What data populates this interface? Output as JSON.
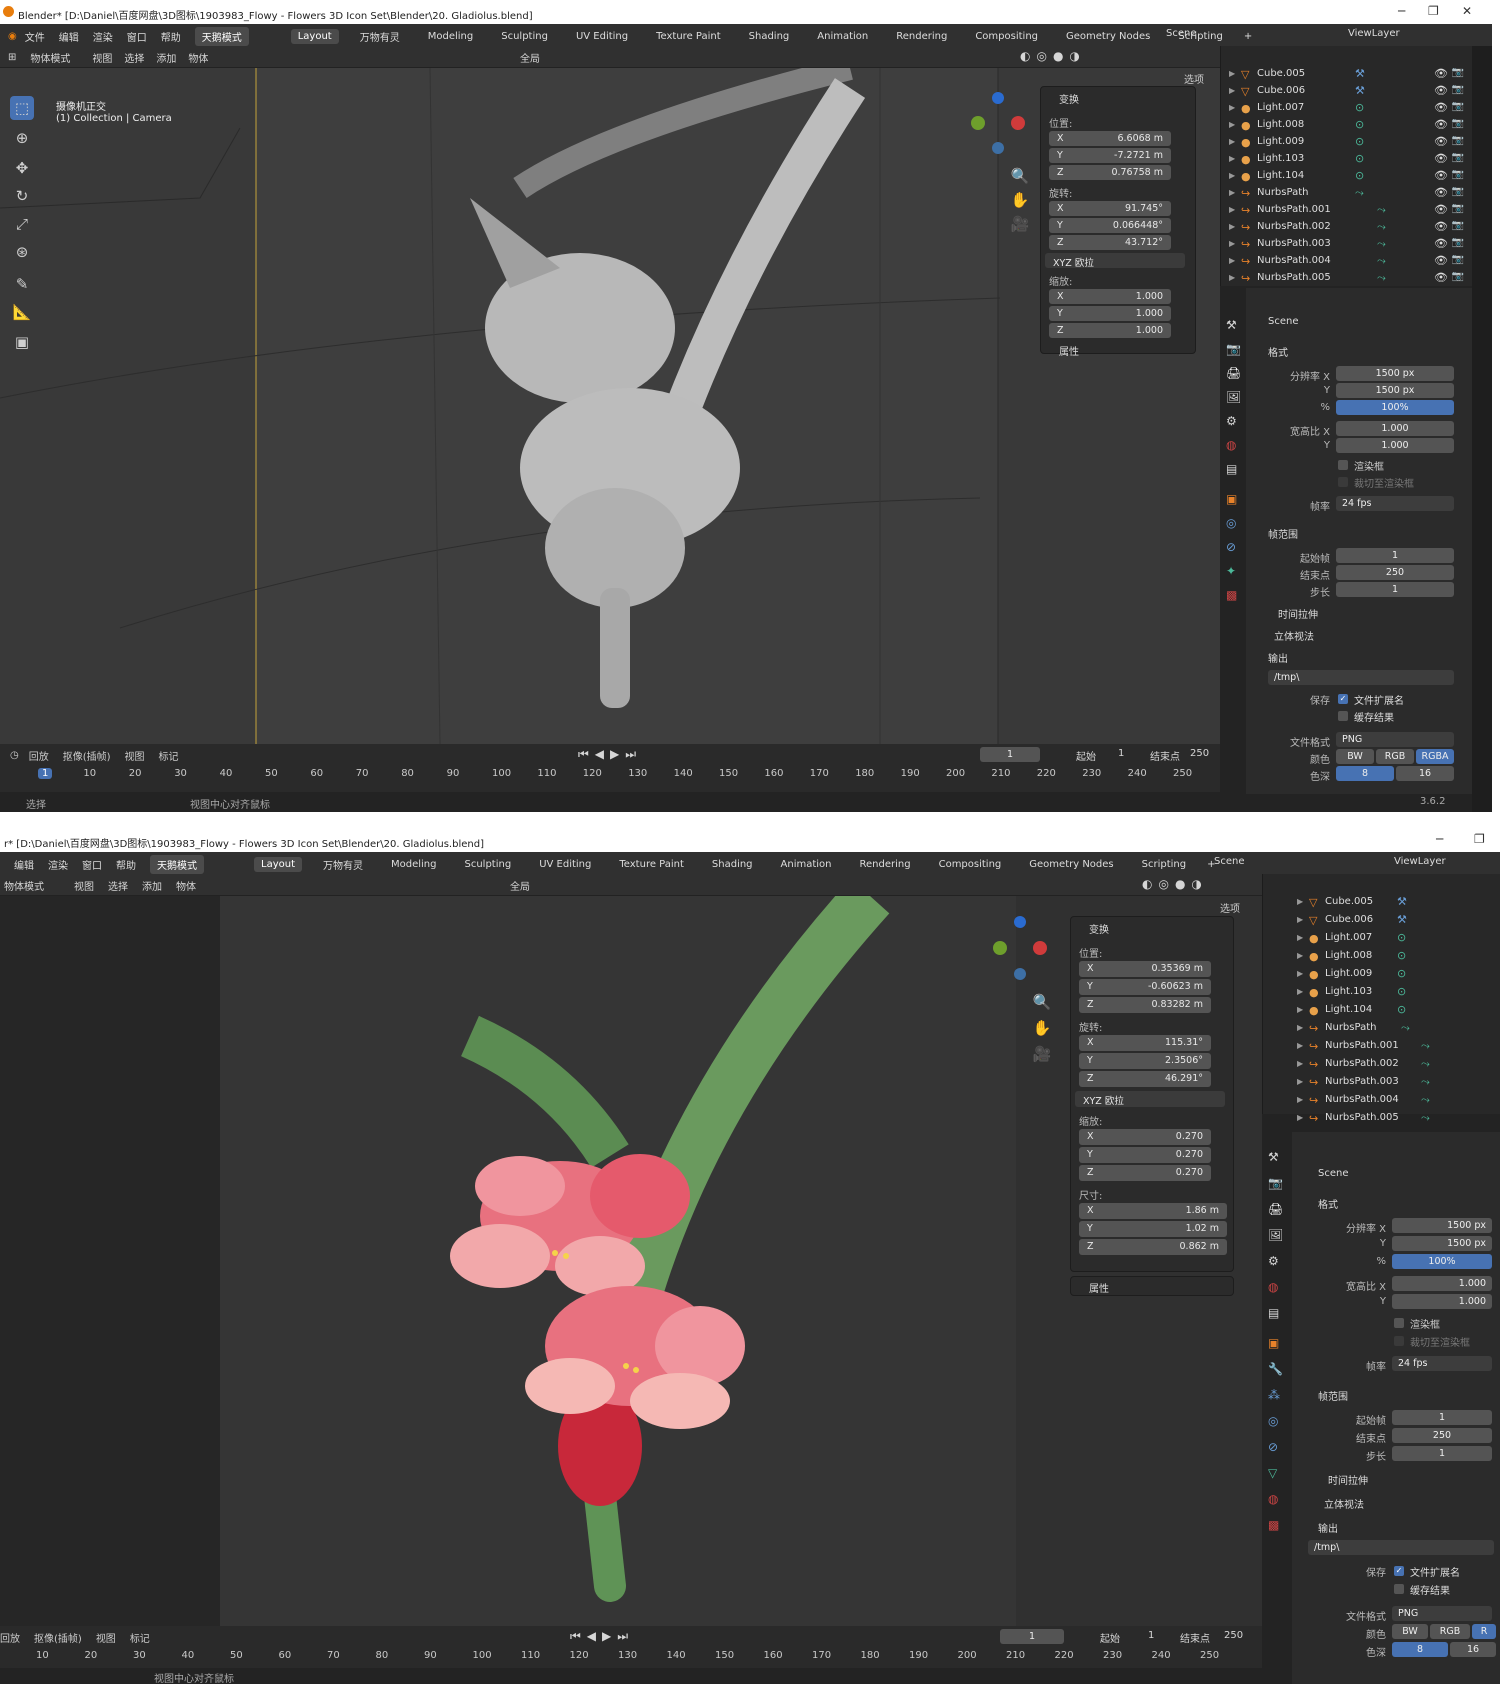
{
  "shot1": {
    "title": "Blender* [D:\\Daniel\\百度网盘\\3D图标\\1903983_Flowy - Flowers 3D Icon Set\\Blender\\20. Gladiolus.blend]",
    "menus": [
      "文件",
      "编辑",
      "渲染",
      "窗口",
      "帮助"
    ],
    "mode_tab": "天鹅模式",
    "workspaces": [
      "Layout",
      "万物有灵",
      "Modeling",
      "Sculpting",
      "UV Editing",
      "Texture Paint",
      "Shading",
      "Animation",
      "Rendering",
      "Compositing",
      "Geometry Nodes",
      "Scripting"
    ],
    "scene": "Scene",
    "view_layer": "ViewLayer",
    "object_mode": "物体模式",
    "header_menus": [
      "视图",
      "选择",
      "添加",
      "物体"
    ],
    "global": "全局",
    "options": "选项",
    "viewport_info": {
      "line1": "摄像机正交",
      "line2": "(1) Collection | Camera"
    },
    "transform": {
      "title": "变换",
      "location_label": "位置:",
      "location": [
        {
          "k": "X",
          "v": "6.6068 m"
        },
        {
          "k": "Y",
          "v": "-7.2721 m"
        },
        {
          "k": "Z",
          "v": "0.76758 m"
        }
      ],
      "rotation_label": "旋转:",
      "rotation": [
        {
          "k": "X",
          "v": "91.745°"
        },
        {
          "k": "Y",
          "v": "0.066448°"
        },
        {
          "k": "Z",
          "v": "43.712°"
        }
      ],
      "rotation_mode": "XYZ 欧拉",
      "scale_label": "缩放:",
      "scale": [
        {
          "k": "X",
          "v": "1.000"
        },
        {
          "k": "Y",
          "v": "1.000"
        },
        {
          "k": "Z",
          "v": "1.000"
        }
      ],
      "attributes": "属性"
    },
    "outliner": [
      "Cube.005",
      "Cube.006",
      "Light.007",
      "Light.008",
      "Light.009",
      "Light.103",
      "Light.104",
      "NurbsPath",
      "NurbsPath.001",
      "NurbsPath.002",
      "NurbsPath.003",
      "NurbsPath.004",
      "NurbsPath.005"
    ],
    "properties": {
      "scene": "Scene",
      "format": "格式",
      "res_x_label": "分辨率 X",
      "res_x": "1500 px",
      "res_y_label": "Y",
      "res_y": "1500 px",
      "pct_label": "%",
      "pct": "100%",
      "aspect_x_label": "宽高比 X",
      "aspect_x": "1.000",
      "aspect_y_label": "Y",
      "aspect_y": "1.000",
      "render_region": "渲染框",
      "crop": "裁切至渲染框",
      "fps_label": "帧率",
      "fps": "24 fps",
      "frame_range": "帧范围",
      "start_label": "起始帧",
      "start": "1",
      "end_label": "结束点",
      "end": "250",
      "step_label": "步长",
      "step": "1",
      "time_stretch": "时间拉伸",
      "stereo": "立体视法",
      "output": "输出",
      "path": "/tmp\\",
      "save_label": "保存",
      "file_ext": "文件扩展名",
      "cache": "缓存结果",
      "file_format_label": "文件格式",
      "file_format": "PNG",
      "color_label": "颜色",
      "color_opts": [
        "BW",
        "RGB",
        "RGBA"
      ],
      "depth_label": "色深",
      "depth_opts": [
        "8",
        "16"
      ],
      "version": "3.6.2"
    },
    "timeline": {
      "menus": [
        "回放",
        "抠像(插帧)",
        "视图",
        "标记"
      ],
      "current": "1",
      "start_label": "起始",
      "start": "1",
      "end_label": "结束点",
      "end": "250",
      "ticks": [
        "1",
        "10",
        "20",
        "30",
        "40",
        "50",
        "60",
        "70",
        "80",
        "90",
        "100",
        "110",
        "120",
        "130",
        "140",
        "150",
        "160",
        "170",
        "180",
        "190",
        "200",
        "210",
        "220",
        "230",
        "240",
        "250"
      ]
    },
    "status": {
      "select": "选择",
      "center": "视图中心对齐鼠标"
    }
  },
  "shot2": {
    "title": "r* [D:\\Daniel\\百度网盘\\3D图标\\1903983_Flowy - Flowers 3D Icon Set\\Blender\\20. Gladiolus.blend]",
    "menus": [
      "编辑",
      "渲染",
      "窗口",
      "帮助"
    ],
    "mode_tab": "天鹅模式",
    "workspaces": [
      "Layout",
      "万物有灵",
      "Modeling",
      "Sculpting",
      "UV Editing",
      "Texture Paint",
      "Shading",
      "Animation",
      "Rendering",
      "Compositing",
      "Geometry Nodes",
      "Scripting"
    ],
    "scene": "Scene",
    "view_layer": "ViewLayer",
    "object_mode": "物体模式",
    "header_menus": [
      "视图",
      "选择",
      "添加",
      "物体"
    ],
    "global": "全局",
    "options": "选项",
    "transform": {
      "title": "变换",
      "location_label": "位置:",
      "location": [
        {
          "k": "X",
          "v": "0.35369 m"
        },
        {
          "k": "Y",
          "v": "-0.60623 m"
        },
        {
          "k": "Z",
          "v": "0.83282 m"
        }
      ],
      "rotation_label": "旋转:",
      "rotation": [
        {
          "k": "X",
          "v": "115.31°"
        },
        {
          "k": "Y",
          "v": "2.3506°"
        },
        {
          "k": "Z",
          "v": "46.291°"
        }
      ],
      "rotation_mode": "XYZ 欧拉",
      "scale_label": "缩放:",
      "scale": [
        {
          "k": "X",
          "v": "0.270"
        },
        {
          "k": "Y",
          "v": "0.270"
        },
        {
          "k": "Z",
          "v": "0.270"
        }
      ],
      "dims_label": "尺寸:",
      "dims": [
        {
          "k": "X",
          "v": "1.86 m"
        },
        {
          "k": "Y",
          "v": "1.02 m"
        },
        {
          "k": "Z",
          "v": "0.862 m"
        }
      ],
      "attributes": "属性"
    },
    "outliner": [
      "Cube.005",
      "Cube.006",
      "Light.007",
      "Light.008",
      "Light.009",
      "Light.103",
      "Light.104",
      "NurbsPath",
      "NurbsPath.001",
      "NurbsPath.002",
      "NurbsPath.003",
      "NurbsPath.004",
      "NurbsPath.005"
    ],
    "properties": {
      "scene": "Scene",
      "format": "格式",
      "res_x_label": "分辨率 X",
      "res_x": "1500 px",
      "res_y_label": "Y",
      "res_y": "1500 px",
      "pct_label": "%",
      "pct": "100%",
      "aspect_x_label": "宽高比 X",
      "aspect_x": "1.000",
      "aspect_y_label": "Y",
      "aspect_y": "1.000",
      "render_region": "渲染框",
      "crop": "裁切至渲染框",
      "fps_label": "帧率",
      "fps": "24 fps",
      "frame_range": "帧范围",
      "start_label": "起始帧",
      "start": "1",
      "end_label": "结束点",
      "end": "250",
      "step_label": "步长",
      "step": "1",
      "time_stretch": "时间拉伸",
      "stereo": "立体视法",
      "output": "输出",
      "path": "/tmp\\",
      "save_label": "保存",
      "file_ext": "文件扩展名",
      "cache": "缓存结果",
      "file_format_label": "文件格式",
      "file_format": "PNG",
      "color_label": "颜色",
      "color_opts": [
        "BW",
        "RGB",
        "R"
      ],
      "depth_label": "色深",
      "depth_opts": [
        "8",
        "16"
      ]
    },
    "timeline": {
      "menus": [
        "回放",
        "抠像(插帧)",
        "视图",
        "标记"
      ],
      "current": "1",
      "start_label": "起始",
      "start": "1",
      "end_label": "结束点",
      "end": "250",
      "ticks": [
        "10",
        "20",
        "30",
        "40",
        "50",
        "60",
        "70",
        "80",
        "90",
        "100",
        "110",
        "120",
        "130",
        "140",
        "150",
        "160",
        "170",
        "180",
        "190",
        "200",
        "210",
        "220",
        "230",
        "240",
        "250"
      ]
    },
    "status": {
      "center": "视图中心对齐鼠标"
    }
  },
  "colors": {
    "accent": "#4772b3",
    "petal": "#e8717f",
    "leaf": "#6a9a5e",
    "orange_icon": "#e8822a"
  }
}
